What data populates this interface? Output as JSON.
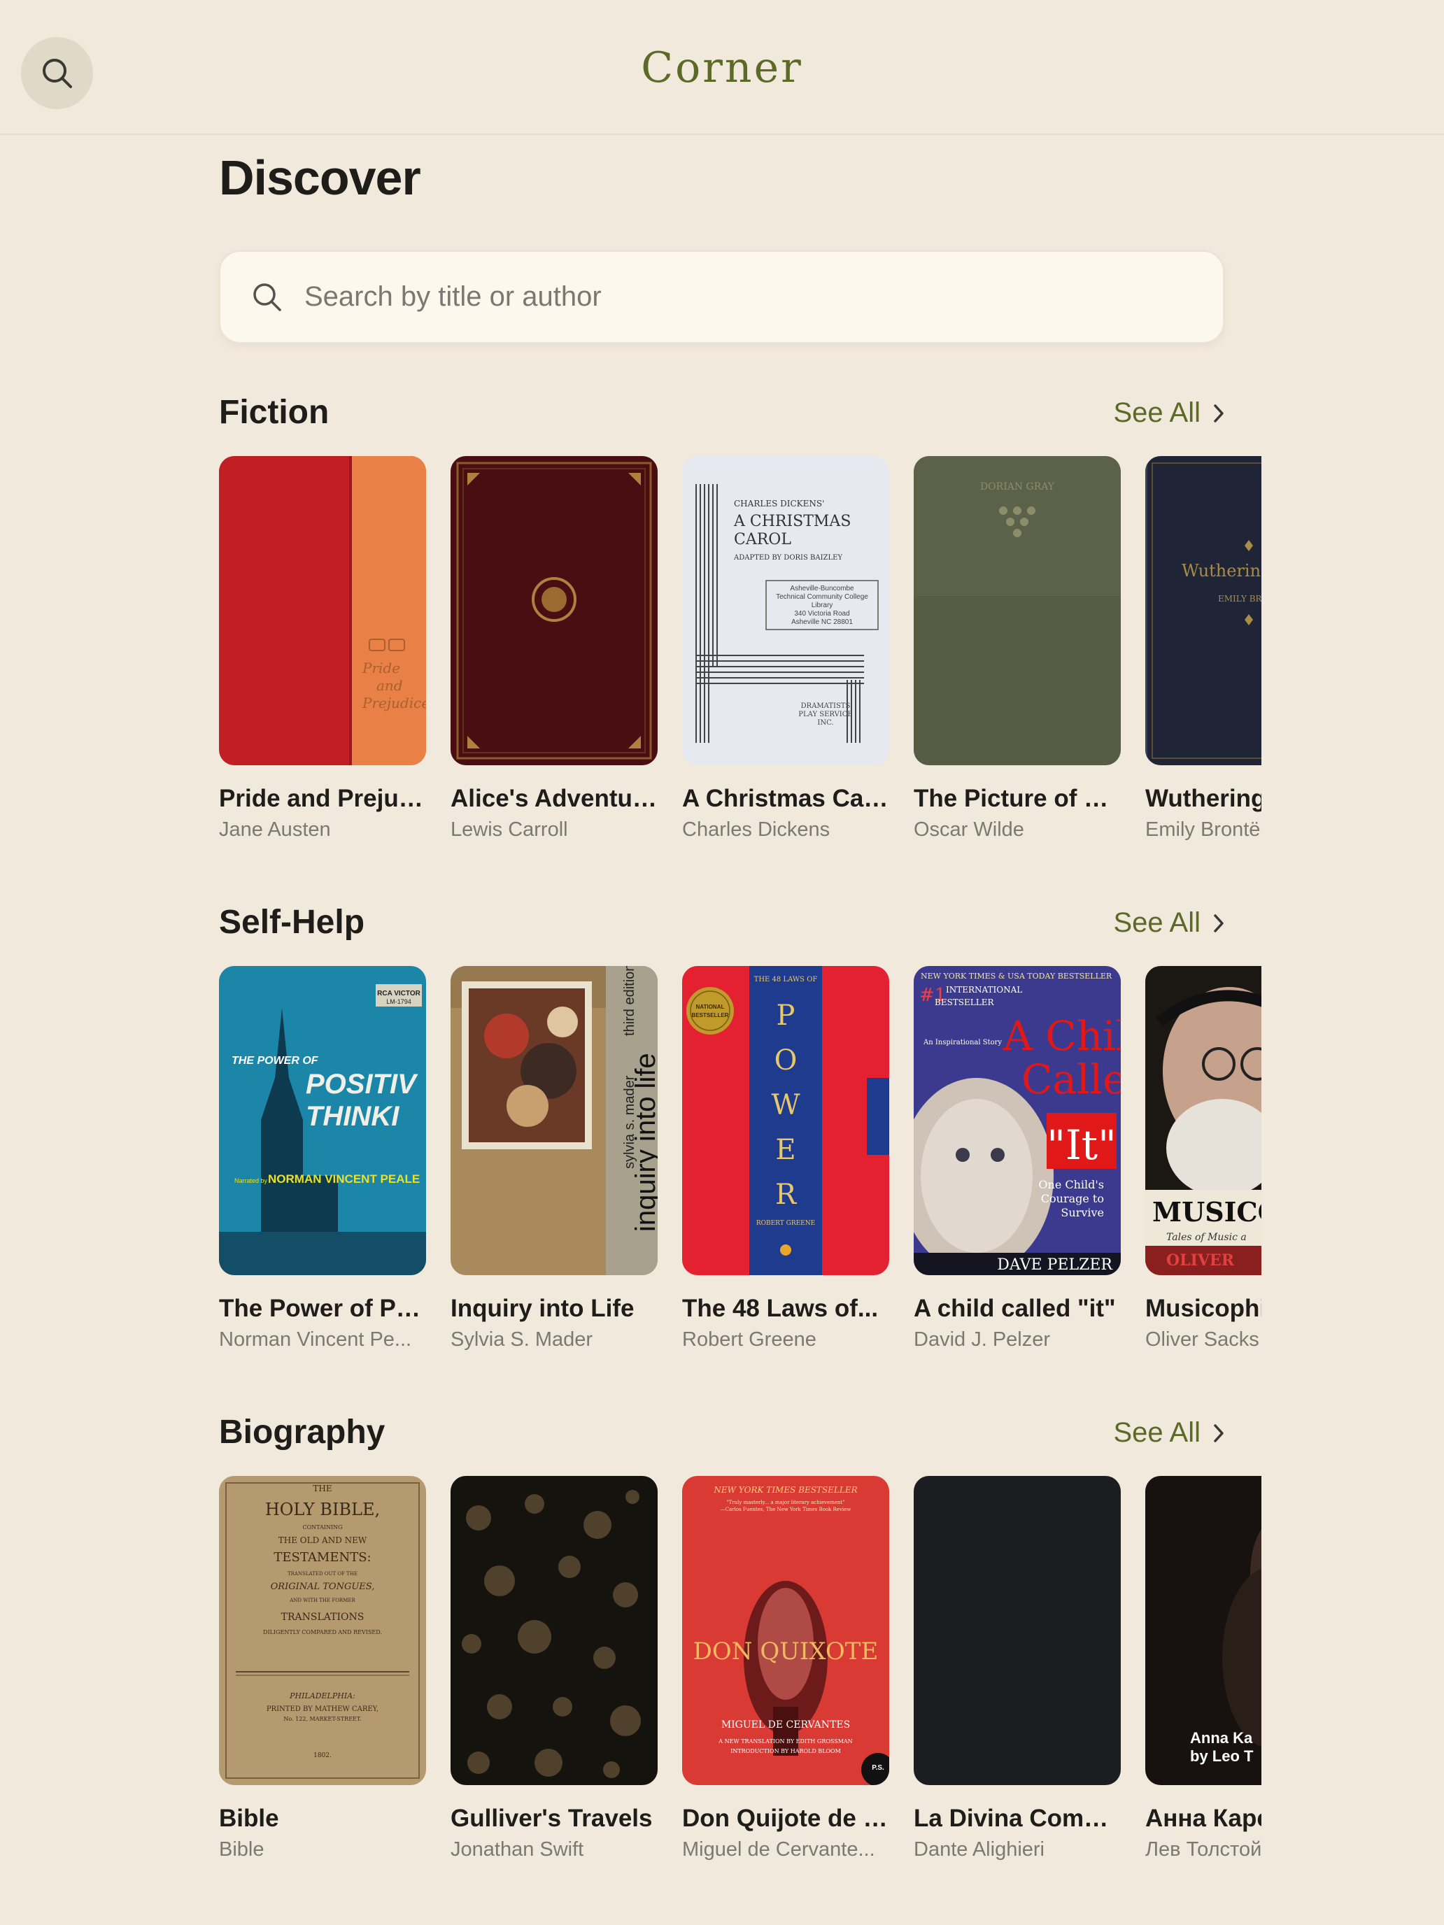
{
  "app": {
    "title": "Corner"
  },
  "page": {
    "title": "Discover"
  },
  "search": {
    "placeholder": "Search by title or author"
  },
  "sections": [
    {
      "title": "Fiction",
      "see_all": "See All",
      "books": [
        {
          "title": "Pride and Prejud...",
          "author": "Jane Austen"
        },
        {
          "title": "Alice's Adventur...",
          "author": "Lewis Carroll"
        },
        {
          "title": "A Christmas Carol",
          "author": "Charles Dickens"
        },
        {
          "title": "The Picture of D...",
          "author": "Oscar Wilde"
        },
        {
          "title": "Wuthering",
          "author": "Emily Brontë"
        }
      ]
    },
    {
      "title": "Self-Help",
      "see_all": "See All",
      "books": [
        {
          "title": "The Power of Po...",
          "author": "Norman Vincent Pe..."
        },
        {
          "title": "Inquiry into Life",
          "author": "Sylvia S. Mader"
        },
        {
          "title": "The 48 Laws of...",
          "author": "Robert Greene"
        },
        {
          "title": "A child called \"it\"",
          "author": "David J. Pelzer"
        },
        {
          "title": "Musicophi",
          "author": "Oliver Sacks"
        }
      ]
    },
    {
      "title": "Biography",
      "see_all": "See All",
      "books": [
        {
          "title": "Bible",
          "author": "Bible"
        },
        {
          "title": "Gulliver's Travels",
          "author": "Jonathan Swift"
        },
        {
          "title": "Don Quijote de l...",
          "author": "Miguel de Cervante..."
        },
        {
          "title": "La Divina Comm...",
          "author": "Dante Alighieri"
        },
        {
          "title": "Анна Каре",
          "author": "Лев Толстой"
        }
      ]
    }
  ],
  "covers": {
    "pride": {
      "text": [
        "Pride",
        "and",
        "Prejudice"
      ]
    },
    "christmas": {
      "text": [
        "CHARLES DICKENS'",
        "A CHRISTMAS",
        "CAROL",
        "ADAPTED BY DORIS BAIZLEY",
        "Asheville-Buncombe",
        "Technical Community College",
        "Library",
        "340 Victoria Road",
        "Asheville NC 28801",
        "DRAMATISTS",
        "PLAY SERVICE",
        "INC."
      ]
    },
    "dorian": {
      "text": [
        "DORIAN GRAY"
      ]
    },
    "wuthering": {
      "text": [
        "Wuthering",
        "EMILY BR"
      ]
    },
    "positive": {
      "text": [
        "RCA VICTOR",
        "LM-1794",
        "THE POWER OF",
        "POSITIV",
        "THINKI",
        "Narrated by",
        "NORMAN VINCENT PEALE"
      ]
    },
    "inquiry": {
      "text": [
        "sylvia s. mader",
        "third edition",
        "inquiry into life"
      ]
    },
    "laws": {
      "text": [
        "THE 48 LAWS OF",
        "NATIONAL",
        "BESTSELLER",
        "P",
        "O",
        "W",
        "E",
        "R",
        "ROBERT GREENE"
      ]
    },
    "child": {
      "text": [
        "NEW YORK TIMES & USA TODAY BESTSELLER",
        "#1",
        "INTERNATIONAL",
        "BESTSELLER",
        "An Inspirational Story",
        "A Child",
        "Called",
        "\"It\"",
        "One Child's",
        "Courage to",
        "Survive",
        "DAVE PELZER"
      ]
    },
    "musico": {
      "text": [
        "MUSICOP",
        "Tales of Music a",
        "OLIVER"
      ]
    },
    "bible": {
      "text": [
        "THE",
        "HOLY BIBLE,",
        "CONTAINING",
        "THE OLD AND NEW",
        "TESTAMENTS:",
        "TRANSLATED OUT OF THE",
        "ORIGINAL TONGUES,",
        "AND WITH THE FORMER",
        "TRANSLATIONS",
        "DILIGENTLY COMPARED AND REVISED.",
        "PHILADELPHIA:",
        "PRINTED BY MATHEW CAREY,",
        "No. 122, MARKET-STREET.",
        "1802."
      ]
    },
    "quixote": {
      "text": [
        "NEW YORK TIMES BESTSELLER",
        "\"Truly masterly... a major literary achievement\"",
        "—Carlos Fuentes, The New York Times Book Review",
        "DON QUIXOTE",
        "MIGUEL DE CERVANTES",
        "A NEW TRANSLATION BY EDITH GROSSMAN",
        "INTRODUCTION BY HAROLD BLOOM",
        "P.S."
      ]
    },
    "anna": {
      "text": [
        "Anna Ka",
        "by Leo T"
      ]
    }
  },
  "icons": {
    "search": "search-icon",
    "chevron": "chevron-right-icon"
  },
  "colors": {
    "background": "#f2e9dd",
    "accent": "#5b6a28",
    "search_bg": "#fdf8ee"
  }
}
